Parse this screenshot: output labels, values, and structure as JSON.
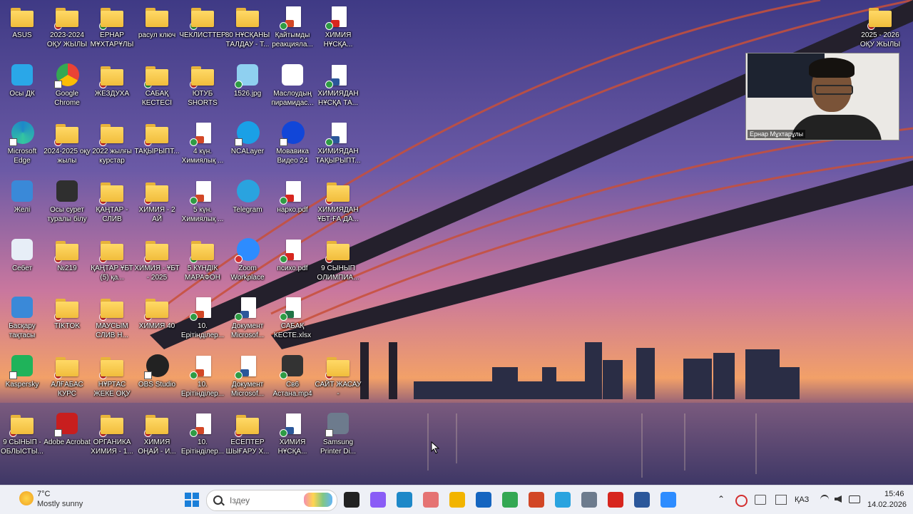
{
  "desktop": {
    "icons": [
      {
        "label": "ASUS",
        "kind": "folder",
        "ov": "",
        "col": 0,
        "row": 0
      },
      {
        "label": "2023-2024 ОҚУ ЖЫЛЫ",
        "kind": "folder",
        "ov": "x",
        "col": 1,
        "row": 0
      },
      {
        "label": "ЕРНАР МҰХТАРҰЛЫ",
        "kind": "folder",
        "ov": "ok",
        "col": 2,
        "row": 0
      },
      {
        "label": "расул ключ",
        "kind": "folder",
        "ov": "",
        "col": 3,
        "row": 0
      },
      {
        "label": "ЧЕКЛИСТТЕР",
        "kind": "folder",
        "ov": "ok",
        "col": 4,
        "row": 0
      },
      {
        "label": "80 НҰСҚАНЫ ТАЛДАУ - Т...",
        "kind": "folder",
        "ov": "",
        "col": 5,
        "row": 0
      },
      {
        "label": "Қайтымды реакцияла...",
        "kind": "ppt",
        "ov": "ok",
        "col": 6,
        "row": 0
      },
      {
        "label": "ХИМИЯ НҰСҚА...",
        "kind": "pdf",
        "ov": "ok",
        "col": 7,
        "row": 0
      },
      {
        "label": "2025 - 2026 ОҚУ ЖЫЛЫ",
        "kind": "folder",
        "ov": "x",
        "col": 19,
        "row": 0
      },
      {
        "label": "Осы ДК",
        "kind": "pc",
        "ov": "",
        "col": 0,
        "row": 1
      },
      {
        "label": "Google Chrome",
        "kind": "chrome",
        "ov": "link",
        "col": 1,
        "row": 1
      },
      {
        "label": "ЖЕЗДУХА",
        "kind": "folder",
        "ov": "x",
        "col": 2,
        "row": 1
      },
      {
        "label": "САБАҚ КЕСТЕСІ",
        "kind": "folder",
        "ov": "ok",
        "col": 3,
        "row": 1
      },
      {
        "label": "ЮТУБ SHORTS",
        "kind": "folder",
        "ov": "x",
        "col": 4,
        "row": 1
      },
      {
        "label": "1526.jpg",
        "kind": "image",
        "ov": "ok",
        "col": 5,
        "row": 1
      },
      {
        "label": "Маслоудың пирамидас...",
        "kind": "image2",
        "ov": "",
        "col": 6,
        "row": 1
      },
      {
        "label": "ХИМИЯДАН НҰСҚА ТА...",
        "kind": "doc",
        "ov": "ok",
        "col": 7,
        "row": 1
      },
      {
        "label": "Microsoft Edge",
        "kind": "edge",
        "ov": "link",
        "col": 0,
        "row": 2
      },
      {
        "label": "2024-2025 оқу жылы",
        "kind": "folder",
        "ov": "x",
        "col": 1,
        "row": 2
      },
      {
        "label": "2022 жылғы курстар",
        "kind": "folder",
        "ov": "x",
        "col": 2,
        "row": 2
      },
      {
        "label": "ТАҚЫРЫПТ...",
        "kind": "folder",
        "ov": "x",
        "col": 3,
        "row": 2
      },
      {
        "label": "4 күн. Химиялық ...",
        "kind": "ppt",
        "ov": "ok",
        "col": 4,
        "row": 2
      },
      {
        "label": "NCALayer",
        "kind": "ncalayer",
        "ov": "link",
        "col": 5,
        "row": 2
      },
      {
        "label": "Мовавика Видео 24",
        "kind": "movavi",
        "ov": "link",
        "col": 6,
        "row": 2
      },
      {
        "label": "ХИМИЯДАН ТАҚЫРЫПТ...",
        "kind": "word",
        "ov": "ok",
        "col": 7,
        "row": 2
      },
      {
        "label": "Желі",
        "kind": "network",
        "ov": "",
        "col": 0,
        "row": 3
      },
      {
        "label": "Осы сурет туралы білу",
        "kind": "camera",
        "ov": "",
        "col": 1,
        "row": 3
      },
      {
        "label": "ҚАҢТАР - СЛИВ",
        "kind": "folder",
        "ov": "x",
        "col": 2,
        "row": 3
      },
      {
        "label": "ХИМИЯ - 2 АЙ",
        "kind": "folder",
        "ov": "x",
        "col": 3,
        "row": 3
      },
      {
        "label": "5 күн. Химиялық ...",
        "kind": "ppt",
        "ov": "ok",
        "col": 4,
        "row": 3
      },
      {
        "label": "Telegram",
        "kind": "telegram",
        "ov": "",
        "col": 5,
        "row": 3
      },
      {
        "label": "нарко.pdf",
        "kind": "pdf",
        "ov": "ok",
        "col": 6,
        "row": 3
      },
      {
        "label": "ХИМИЯДАН ҰБТ-ҒА ДА...",
        "kind": "folder",
        "ov": "x",
        "col": 7,
        "row": 3
      },
      {
        "label": "Себет",
        "kind": "recycle",
        "ov": "",
        "col": 0,
        "row": 4
      },
      {
        "label": "№219",
        "kind": "folder",
        "ov": "x",
        "col": 1,
        "row": 4
      },
      {
        "label": "ҚАҢТАР ҰБТ (5) қа...",
        "kind": "folder",
        "ov": "x",
        "col": 2,
        "row": 4
      },
      {
        "label": "ХИМИЯ - ҰБТ - 2025",
        "kind": "folder",
        "ov": "x",
        "col": 3,
        "row": 4
      },
      {
        "label": "5 КҮНДІК МАРАФОН",
        "kind": "folder",
        "ov": "ok",
        "col": 4,
        "row": 4
      },
      {
        "label": "Zoom Workplace",
        "kind": "zoom",
        "ov": "x",
        "col": 5,
        "row": 4
      },
      {
        "label": "психо.pdf",
        "kind": "pdf",
        "ov": "ok",
        "col": 6,
        "row": 4
      },
      {
        "label": "9 СЫНЫП ОЛИМПИА...",
        "kind": "folder",
        "ov": "x",
        "col": 7,
        "row": 4
      },
      {
        "label": "Басқару тақтасы",
        "kind": "control",
        "ov": "",
        "col": 0,
        "row": 5
      },
      {
        "label": "TIKTOK",
        "kind": "folder",
        "ov": "x",
        "col": 1,
        "row": 5
      },
      {
        "label": "МАУСЫМ СЛИВ Н...",
        "kind": "folder",
        "ov": "x",
        "col": 2,
        "row": 5
      },
      {
        "label": "ХИМИЯ 40",
        "kind": "folder",
        "ov": "x",
        "col": 3,
        "row": 5
      },
      {
        "label": "10. Ерітінділер...",
        "kind": "ppt",
        "ov": "ok",
        "col": 4,
        "row": 5
      },
      {
        "label": "Документ Microsof...",
        "kind": "word",
        "ov": "ok",
        "col": 5,
        "row": 5
      },
      {
        "label": "САБАҚ КЕСТЕ.xlsx",
        "kind": "excel",
        "ov": "ok",
        "col": 6,
        "row": 5
      },
      {
        "label": "Kaspersky",
        "kind": "kaspersky",
        "ov": "link",
        "col": 0,
        "row": 6
      },
      {
        "label": "АЛҒАБАС КУРС",
        "kind": "folder",
        "ov": "x",
        "col": 1,
        "row": 6
      },
      {
        "label": "НҰРТАС ЖЕКЕ ОҚУ",
        "kind": "folder",
        "ov": "x",
        "col": 2,
        "row": 6
      },
      {
        "label": "OBS Studio",
        "kind": "obs",
        "ov": "link",
        "col": 3,
        "row": 6
      },
      {
        "label": "10. Ерітінділер...",
        "kind": "ppt",
        "ov": "ok",
        "col": 4,
        "row": 6
      },
      {
        "label": "Документ Microsof...",
        "kind": "doc",
        "ov": "ok",
        "col": 5,
        "row": 6
      },
      {
        "label": "Св6 Астана.mp4",
        "kind": "video",
        "ov": "ok",
        "col": 6,
        "row": 6
      },
      {
        "label": "САЙТ ЖАСАУ -",
        "kind": "folder",
        "ov": "x",
        "col": 7,
        "row": 6
      },
      {
        "label": "9 СЫНЫП - ОБЛЫСТЫ...",
        "kind": "folder",
        "ov": "x",
        "col": 0,
        "row": 7
      },
      {
        "label": "Adobe Acrobat",
        "kind": "acrobat",
        "ov": "link",
        "col": 1,
        "row": 7
      },
      {
        "label": "ОРГАНИКА ХИМИЯ - 1...",
        "kind": "folder",
        "ov": "x",
        "col": 2,
        "row": 7
      },
      {
        "label": "ХИМИЯ ОҢАЙ - И...",
        "kind": "folder",
        "ov": "x",
        "col": 3,
        "row": 7
      },
      {
        "label": "10. Ерітінділер...",
        "kind": "ppt",
        "ov": "ok",
        "col": 4,
        "row": 7
      },
      {
        "label": "ЕСЕПТЕР ШЫҒАРУ Х...",
        "kind": "folder",
        "ov": "x",
        "col": 5,
        "row": 7
      },
      {
        "label": "ХИМИЯ НҰСҚА...",
        "kind": "word",
        "ov": "ok",
        "col": 6,
        "row": 7
      },
      {
        "label": "Samsung Printer Di...",
        "kind": "printer",
        "ov": "link",
        "col": 7,
        "row": 7
      }
    ]
  },
  "webcam": {
    "name": "Ернар Мұхтарұлы"
  },
  "taskbar": {
    "weather": {
      "temp": "7°C",
      "condition": "Mostly sunny"
    },
    "search_placeholder": "Іздеу",
    "apps": [
      {
        "name": "task-view-icon",
        "color": "#222222"
      },
      {
        "name": "copilot-icon",
        "color": "#8a5cf6"
      },
      {
        "name": "edge-icon",
        "color": "#1e88c8"
      },
      {
        "name": "snipping-tool-icon",
        "color": "#e57373"
      },
      {
        "name": "file-explorer-icon",
        "color": "#f2b400"
      },
      {
        "name": "store-icon",
        "color": "#1565c0"
      },
      {
        "name": "chrome-icon",
        "color": "#34a853"
      },
      {
        "name": "powerpoint-icon",
        "color": "#d24726"
      },
      {
        "name": "telegram-icon",
        "color": "#2aa3df"
      },
      {
        "name": "app-icon",
        "color": "#6d7b8d"
      },
      {
        "name": "acrobat-icon",
        "color": "#d7261e"
      },
      {
        "name": "word-icon",
        "color": "#2b579a"
      },
      {
        "name": "zoom-icon",
        "color": "#2d8cff"
      }
    ],
    "tray": {
      "language": "ҚАЗ",
      "time": "15:46",
      "date": "14.02.2026"
    }
  }
}
